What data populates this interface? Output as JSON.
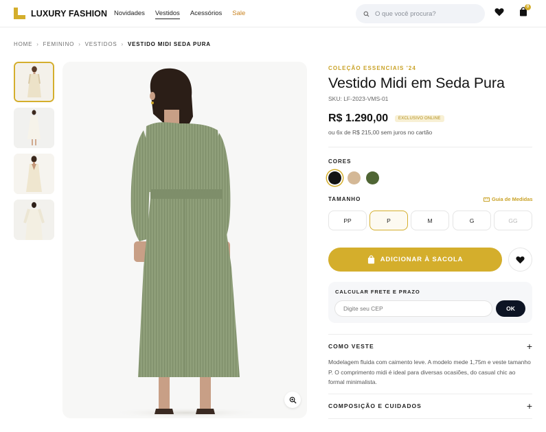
{
  "header": {
    "brand": "LUXURY FASHION",
    "nav": [
      "Novidades",
      "Vestidos",
      "Acessórios",
      "Sale"
    ],
    "search_placeholder": "O que você procura?",
    "cart_count": "0"
  },
  "breadcrumb": [
    "HOME",
    "FEMININO",
    "VESTIDOS",
    "VESTIDO MIDI SEDA PURA"
  ],
  "product": {
    "collection": "COLEÇÃO ESSENCIAIS '24",
    "title": "Vestido Midi em Seda Pura",
    "sku": "SKU: LF-2023-VMS-01",
    "price": "R$ 1.290,00",
    "badge": "EXCLUSIVO ONLINE",
    "installments": "ou 6x de R$ 215,00 sem juros no cartão"
  },
  "colors": {
    "label": "CORES",
    "swatches": [
      "#141414",
      "#d4b896",
      "#4f6534"
    ],
    "selected": 0
  },
  "sizes": {
    "label": "TAMANHO",
    "guide": "Guia de Medidas",
    "options": [
      "PP",
      "P",
      "M",
      "G",
      "GG"
    ],
    "selected": "P",
    "unavailable": "GG"
  },
  "actions": {
    "add_to_bag": "ADICIONAR À SACOLA"
  },
  "shipping": {
    "label": "CALCULAR FRETE E PRAZO",
    "placeholder": "Digite seu CEP",
    "button": "OK"
  },
  "accordions": [
    {
      "title": "COMO VESTE",
      "body": "Modelagem fluida com caimento leve. A modelo mede 1,75m e veste tamanho P. O comprimento midi é ideal para diversas ocasiões, do casual chic ao formal minimalista."
    },
    {
      "title": "COMPOSIÇÃO E CUIDADOS"
    }
  ],
  "theme": {
    "accent": "#d4ae2c",
    "dark": "#0d1424",
    "dress_color": "#8e9f79"
  }
}
